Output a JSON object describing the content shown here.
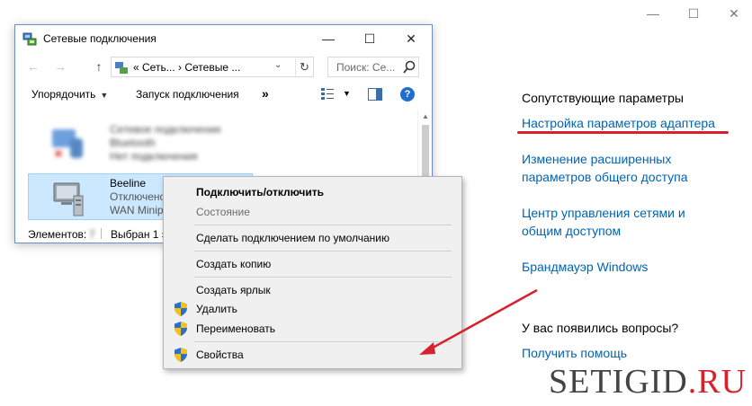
{
  "bg_window_controls": [
    "—",
    "☐",
    "✕"
  ],
  "window": {
    "title": "Сетевые подключения",
    "controls": [
      "—",
      "☐",
      "✕"
    ],
    "address": {
      "crumbs": "«  Сеть...  ›  Сетевые ...",
      "dropdown": "⌄",
      "refresh": "↻"
    },
    "search_placeholder": "Поиск: Се...",
    "nav": {
      "back": "←",
      "forward": "→",
      "up": "↑"
    },
    "toolbar": {
      "organize": "Упорядочить",
      "start_connection": "Запуск подключения",
      "more": "»",
      "help": "?"
    },
    "items": [
      {
        "line1": "Сетевое подключение",
        "line2": "Bluetooth",
        "line3": "Нет подключения",
        "blurred": true
      },
      {
        "line1": "Beeline",
        "line2": "Отключено",
        "line3": "WAN Minip",
        "selected": true
      }
    ],
    "status": {
      "count_label": "Элементов:",
      "count_value": "7",
      "selected_label": "Выбран 1 э"
    }
  },
  "context_menu": {
    "items": [
      {
        "label": "Подключить/отключить",
        "bold": true,
        "shield": false
      },
      {
        "label": "Состояние",
        "disabled": true,
        "shield": false
      },
      {
        "label": "Сделать подключением по умолчанию",
        "shield": false
      },
      {
        "label": "Создать копию",
        "shield": false
      },
      {
        "label": "Создать ярлык",
        "shield": false
      },
      {
        "label": "Удалить",
        "shield": true
      },
      {
        "label": "Переименовать",
        "shield": true
      },
      {
        "label": "Свойства",
        "shield": true
      }
    ]
  },
  "settings_panel": {
    "related_heading": "Сопутствующие параметры",
    "links": [
      "Настройка параметров адаптера",
      "Изменение расширенных",
      "параметров общего доступа",
      "Центр управления сетями и",
      "общим доступом",
      "Брандмауэр Windows"
    ],
    "questions_heading": "У вас появились вопросы?",
    "help_link": "Получить помощь"
  },
  "watermark": {
    "main": "SETIGID",
    "suffix": ".RU"
  },
  "colors": {
    "link": "#0063b1",
    "annotation_red": "#d6222c",
    "selection": "#cce8ff"
  }
}
